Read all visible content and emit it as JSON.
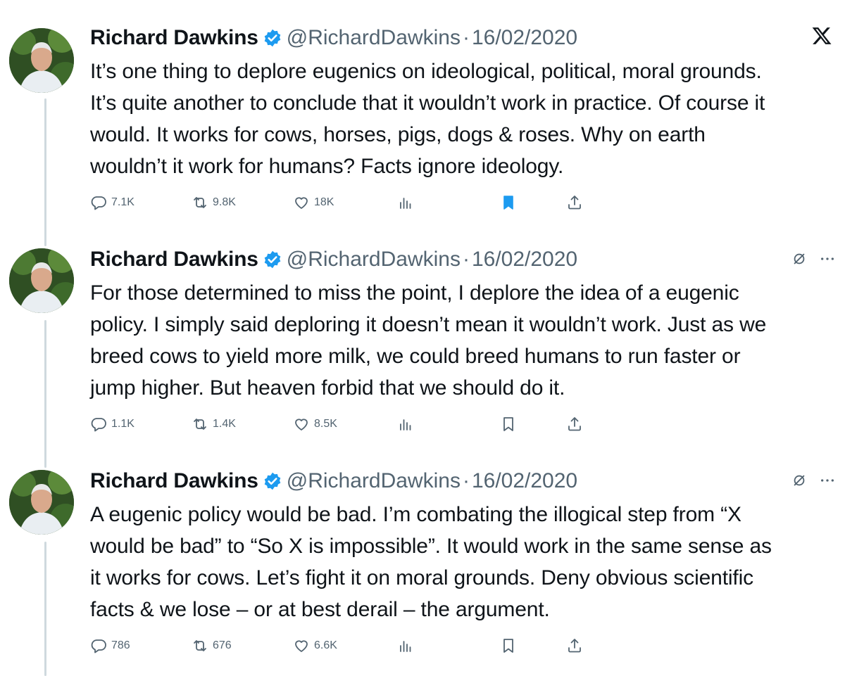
{
  "thread": {
    "tweets": [
      {
        "author_name": "Richard Dawkins",
        "handle": "@RichardDawkins",
        "separator": "·",
        "date": "16/02/2020",
        "text_lines": [
          "It’s one thing to deplore eugenics on ideological, political, moral grounds.",
          "It’s quite another to conclude that it wouldn’t work in practice. Of course it",
          "would. It works for cows, horses, pigs, dogs & roses. Why on earth",
          "wouldn’t it work for humans? Facts ignore ideology."
        ],
        "replies": "7.1K",
        "reposts": "9.8K",
        "likes": "18K",
        "bookmarked": true
      },
      {
        "author_name": "Richard Dawkins",
        "handle": "@RichardDawkins",
        "separator": "·",
        "date": "16/02/2020",
        "text_lines": [
          "For those determined to miss the point, I deplore the idea of a eugenic",
          "policy. I simply said deploring it doesn’t mean it wouldn’t work. Just as we",
          "breed cows to yield more milk, we could breed humans to run faster or",
          "jump higher. But heaven forbid that we should do it."
        ],
        "replies": "1.1K",
        "reposts": "1.4K",
        "likes": "8.5K",
        "bookmarked": false
      },
      {
        "author_name": "Richard Dawkins",
        "handle": "@RichardDawkins",
        "separator": "·",
        "date": "16/02/2020",
        "text_lines": [
          "A eugenic policy would be bad. I’m combating the illogical step from “X",
          "would be bad” to “So X is impossible”. It would work in the same sense as",
          "it works for cows. Let’s fight it on moral grounds. Deny obvious scientific",
          "facts & we lose – or at best derail – the argument."
        ],
        "replies": "786",
        "reposts": "676",
        "likes": "6.6K",
        "bookmarked": false
      }
    ]
  },
  "colors": {
    "text": "#0f1419",
    "muted": "#536471",
    "verified": "#1d9bf0",
    "thread_line": "#cfd9de"
  },
  "icons": [
    "x-logo-icon",
    "verified-badge-icon",
    "reply-icon",
    "repost-icon",
    "like-icon",
    "views-icon",
    "bookmark-icon",
    "share-icon",
    "grok-icon",
    "more-icon"
  ]
}
